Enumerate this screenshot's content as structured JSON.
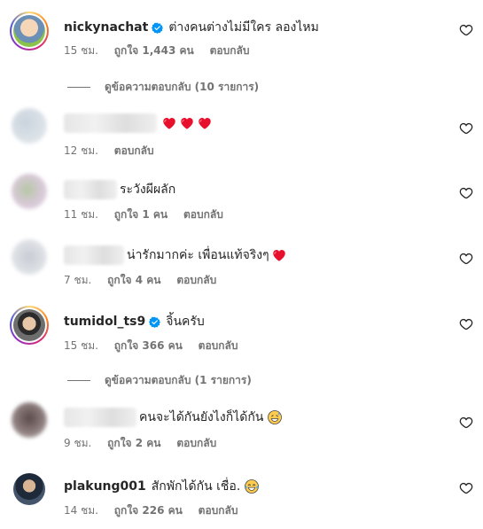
{
  "comments": [
    {
      "username": "nickynachat",
      "verified": true,
      "text": "ต่างคนต่างไม่มีใคร ลองไหม",
      "time": "15 ชม.",
      "likes": "ถูกใจ 1,443 คน",
      "reply": "ตอบกลับ",
      "view_replies": "ดูข้อความตอบกลับ (10 รายการ)"
    },
    {
      "username": "",
      "text": "",
      "time": "12 ชม.",
      "reply": "ตอบกลับ"
    },
    {
      "username": "",
      "text": "ระวังผีผลัก",
      "time": "11 ชม.",
      "likes": "ถูกใจ 1 คน",
      "reply": "ตอบกลับ"
    },
    {
      "username": "",
      "text": "น่ารักมากค่ะ เพื่อนแท้จริงๆ",
      "time": "7 ชม.",
      "likes": "ถูกใจ 4 คน",
      "reply": "ตอบกลับ"
    },
    {
      "username": "tumidol_ts9",
      "verified": true,
      "text": "จิ้นครับ",
      "time": "15 ชม.",
      "likes": "ถูกใจ 366 คน",
      "reply": "ตอบกลับ",
      "view_replies": "ดูข้อความตอบกลับ (1 รายการ)"
    },
    {
      "username": "",
      "text": "คนจะได้กันยังไงก็ได้กัน",
      "time": "9 ชม.",
      "likes": "ถูกใจ 2 คน",
      "reply": "ตอบกลับ"
    },
    {
      "username": "plakung001",
      "text": "สักพักได้กัน เชื่อ.",
      "time": "14 ชม.",
      "likes": "ถูกใจ 226 คน",
      "reply": "ตอบกลับ"
    }
  ],
  "colors": {
    "text": "#262626",
    "meta": "#737373",
    "verified": "#0095f6",
    "heart": "#ff3040"
  }
}
